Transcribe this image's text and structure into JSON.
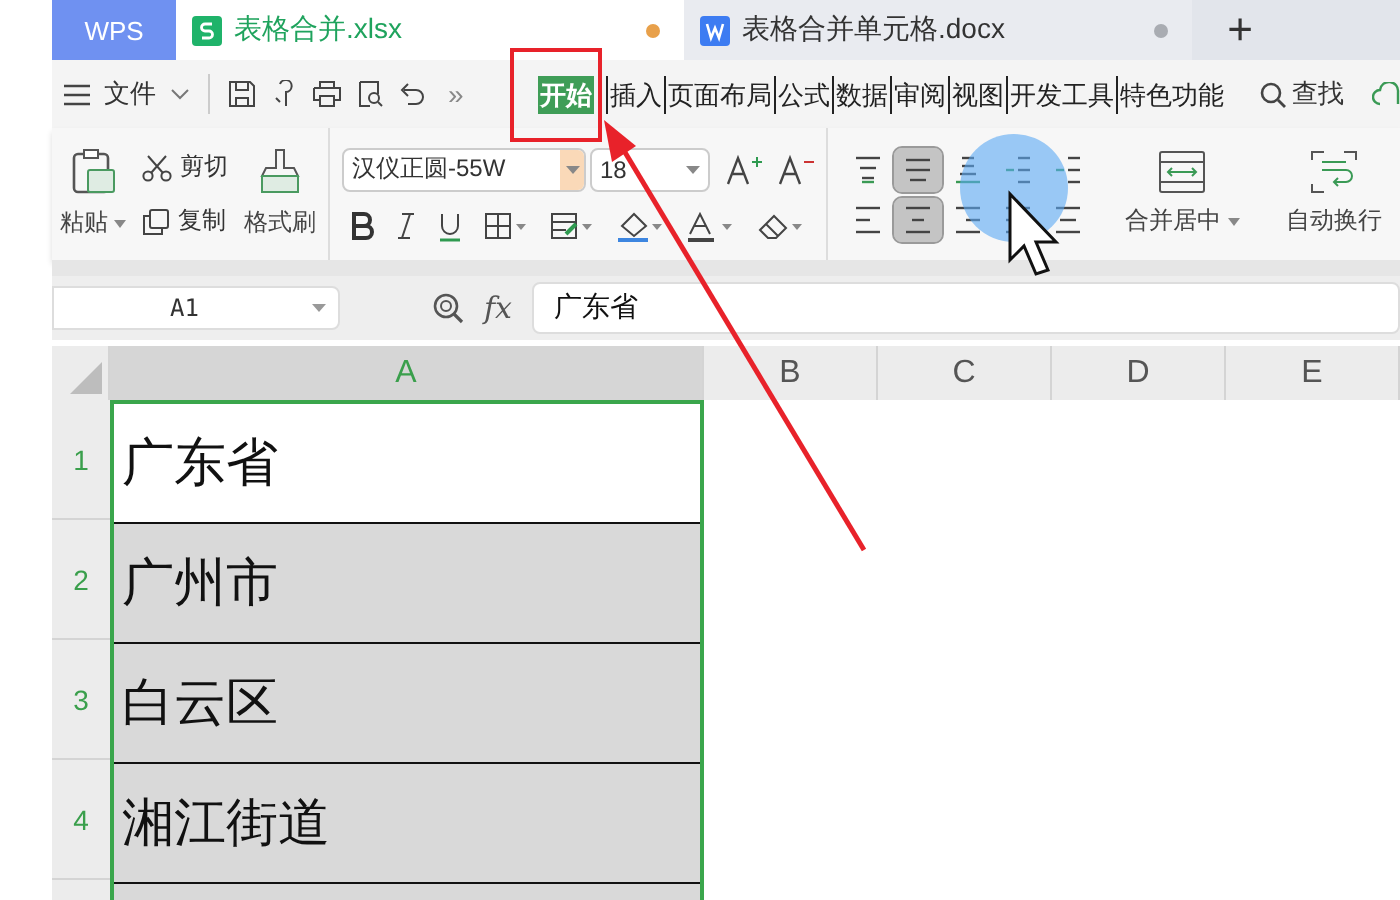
{
  "app_tab": {
    "label": "WPS"
  },
  "doc_tabs": [
    {
      "label": "表格合并.xlsx",
      "kind": "sheet",
      "selected": true
    },
    {
      "label": "表格合并单元格.docx",
      "kind": "doc",
      "selected": false
    }
  ],
  "new_tab": "+",
  "menu": {
    "file": "文件",
    "more": "»",
    "find": "查找",
    "tabs": [
      {
        "label": "开始",
        "selected": true
      },
      {
        "label": "插入",
        "selected": false
      },
      {
        "label": "页面布局",
        "selected": false
      },
      {
        "label": "公式",
        "selected": false
      },
      {
        "label": "数据",
        "selected": false
      },
      {
        "label": "审阅",
        "selected": false
      },
      {
        "label": "视图",
        "selected": false
      },
      {
        "label": "开发工具",
        "selected": false
      },
      {
        "label": "特色功能",
        "selected": false
      }
    ]
  },
  "ribbon": {
    "paste": "粘贴",
    "cut": "剪切",
    "copy": "复制",
    "format_painter": "格式刷",
    "font_name": "汉仪正圆-55W",
    "font_size": "18",
    "align_buttons": [
      {
        "kind": "top",
        "selected": false
      },
      {
        "kind": "middle",
        "selected": true
      },
      {
        "kind": "bottom",
        "selected": false
      },
      {
        "kind": "outdent",
        "selected": false
      },
      {
        "kind": "indent",
        "selected": false
      },
      {
        "kind": "left",
        "selected": false
      },
      {
        "kind": "center",
        "selected": true
      },
      {
        "kind": "right",
        "selected": false
      },
      {
        "kind": "justify",
        "selected": false
      },
      {
        "kind": "distribute",
        "selected": false
      }
    ],
    "merge": "合并居中",
    "wrap": "自动换行"
  },
  "formula_bar": {
    "name_box": "A1",
    "fx": "fx",
    "value": "广东省"
  },
  "columns": [
    {
      "label": "A",
      "selected": true
    },
    {
      "label": "B",
      "selected": false
    },
    {
      "label": "C",
      "selected": false
    },
    {
      "label": "D",
      "selected": false
    },
    {
      "label": "E",
      "selected": false
    }
  ],
  "rows": [
    {
      "number": "1",
      "value": "广东省",
      "selected": true,
      "active": true
    },
    {
      "number": "2",
      "value": "广州市",
      "selected": true,
      "active": false
    },
    {
      "number": "3",
      "value": "白云区",
      "selected": true,
      "active": false
    },
    {
      "number": "4",
      "value": "湘江街道",
      "selected": true,
      "active": false
    }
  ]
}
